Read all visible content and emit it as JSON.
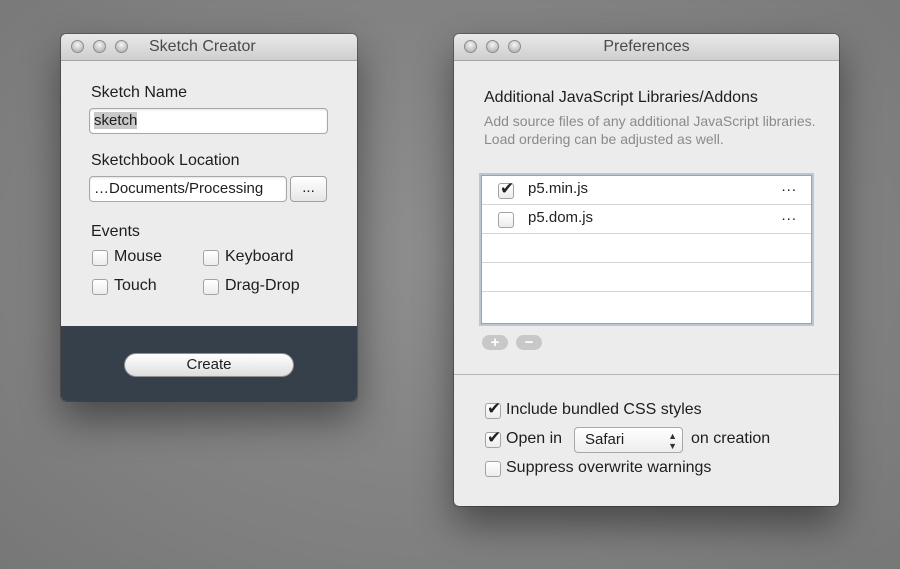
{
  "sketch_creator": {
    "title": "Sketch Creator",
    "sketch_name_label": "Sketch Name",
    "sketch_name_value": "sketch",
    "location_label": "Sketchbook Location",
    "location_value": "…Documents/Processing",
    "browse_label": "...",
    "events_label": "Events",
    "events": [
      {
        "label": "Mouse",
        "checked": false
      },
      {
        "label": "Keyboard",
        "checked": false
      },
      {
        "label": "Touch",
        "checked": false
      },
      {
        "label": "Drag-Drop",
        "checked": false
      }
    ],
    "create_label": "Create"
  },
  "preferences": {
    "title": "Preferences",
    "heading": "Additional JavaScript Libraries/Addons",
    "description": "Add source files of any additional JavaScript libraries. Load ordering can be adjusted as well.",
    "libraries": [
      {
        "name": "p5.min.js",
        "checked": true,
        "more": "..."
      },
      {
        "name": "p5.dom.js",
        "checked": false,
        "more": "..."
      }
    ],
    "add_label": "+",
    "remove_label": "−",
    "include_css_label": "Include bundled CSS styles",
    "include_css_checked": true,
    "open_in_label": "Open in",
    "open_in_checked": true,
    "browser_value": "Safari",
    "on_creation_label": "on creation",
    "suppress_label": "Suppress overwrite warnings",
    "suppress_checked": false
  }
}
